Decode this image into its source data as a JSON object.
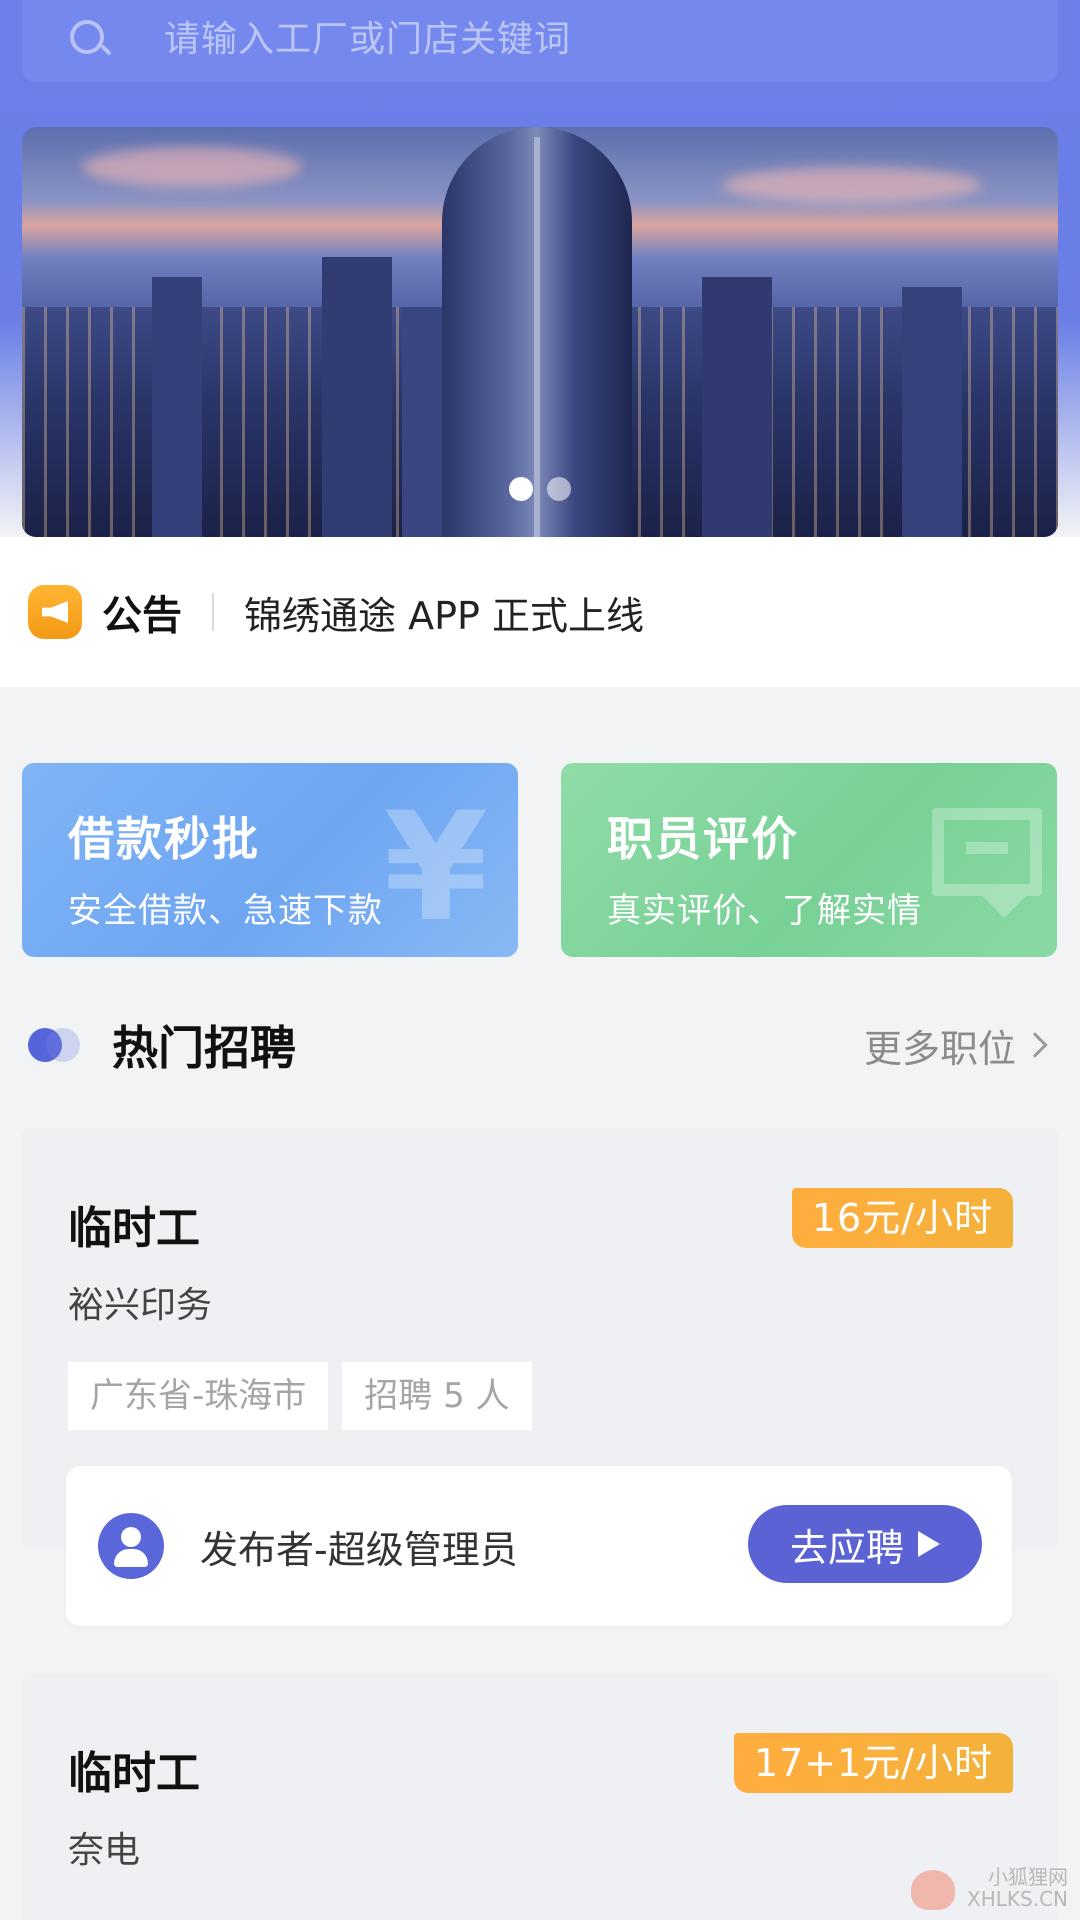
{
  "search": {
    "placeholder": "请输入工厂或门店关键词",
    "icon": "search-icon"
  },
  "banner": {
    "slides": 2,
    "active_index": 0
  },
  "notice": {
    "icon": "megaphone-icon",
    "title": "公告",
    "text": "锦绣通途 APP 正式上线",
    "icon_color": "#f5a623"
  },
  "features": [
    {
      "title": "借款秒批",
      "subtitle": "安全借款、急速下款",
      "icon": "yen-icon",
      "color": "#7cb1f5"
    },
    {
      "title": "职员评价",
      "subtitle": "真实评价、了解实情",
      "icon": "chat-icon",
      "color": "#84d8a0"
    }
  ],
  "hot_jobs": {
    "title": "热门招聘",
    "more_label": "更多职位",
    "jobs": [
      {
        "title": "临时工",
        "salary": "16元/小时",
        "company": "裕兴印务",
        "location": "广东省-珠海市",
        "headcount": "招聘 5 人",
        "publisher": "发布者-超级管理员",
        "apply_label": "去应聘"
      },
      {
        "title": "临时工",
        "salary": "17+1元/小时",
        "company": "奈电"
      }
    ]
  },
  "watermark": {
    "line1": "小狐狸网",
    "line2": "XHLKS.CN"
  },
  "colors": {
    "header": "#6b7eea",
    "accent": "#5b63d4",
    "salary": "#f5a623"
  }
}
